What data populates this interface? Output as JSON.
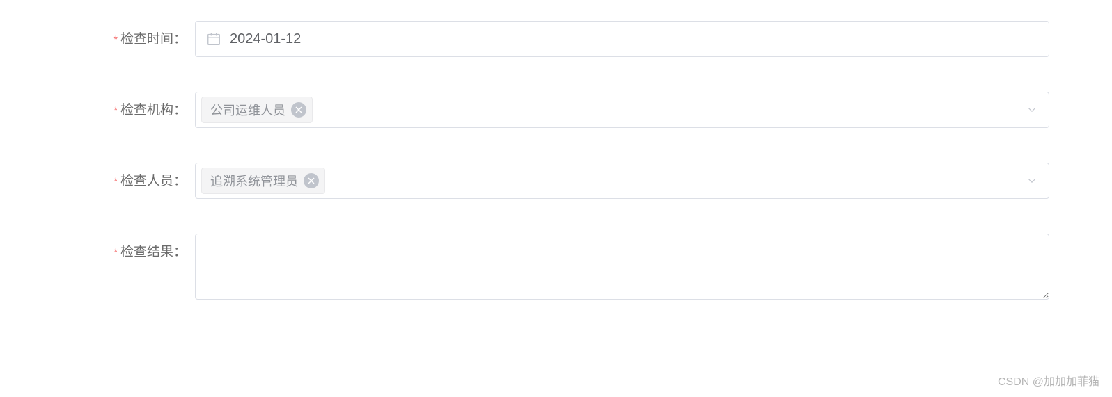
{
  "form": {
    "inspection_time": {
      "label": "检查时间：",
      "value": "2024-01-12"
    },
    "inspection_org": {
      "label": "检查机构：",
      "tags": [
        {
          "text": "公司运维人员"
        }
      ]
    },
    "inspector": {
      "label": "检查人员：",
      "tags": [
        {
          "text": "追溯系统管理员"
        }
      ]
    },
    "inspection_result": {
      "label": "检查结果：",
      "value": ""
    }
  },
  "watermark": "CSDN @加加加菲猫"
}
